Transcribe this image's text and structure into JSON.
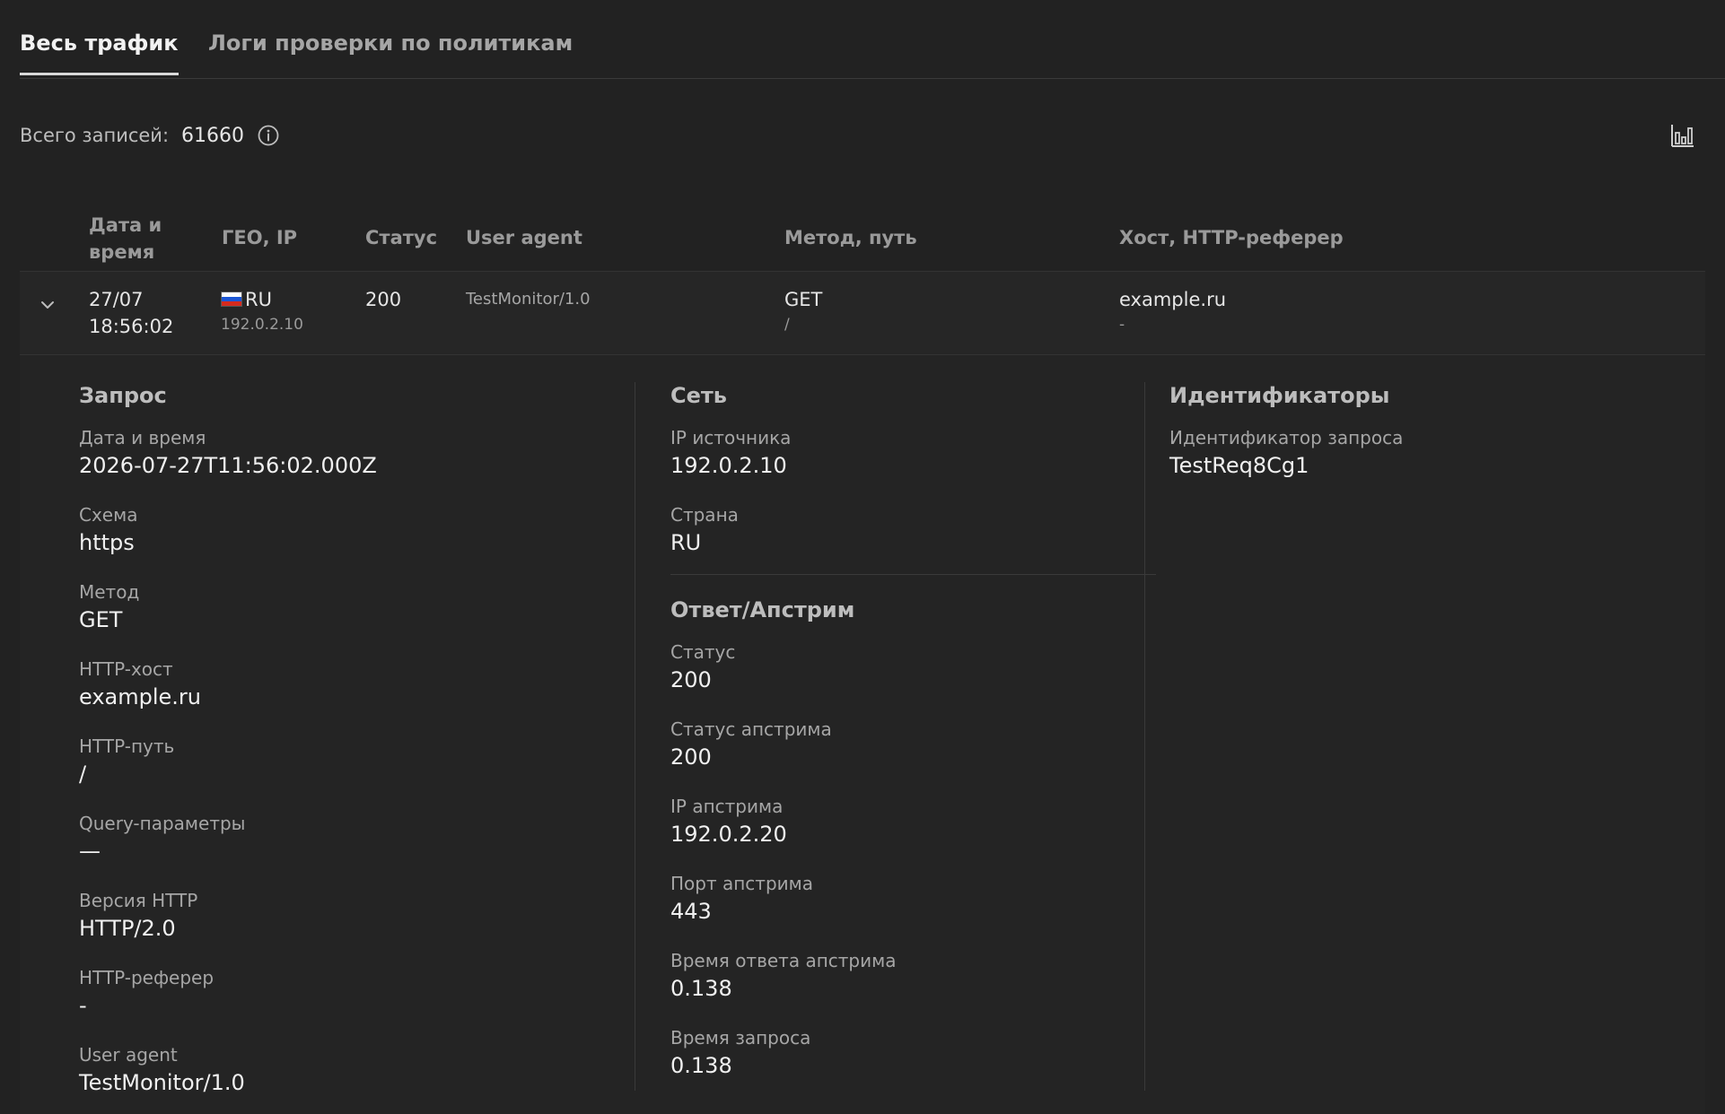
{
  "tabs": [
    {
      "label": "Весь трафик",
      "active": true
    },
    {
      "label": "Логи проверки по политикам",
      "active": false
    }
  ],
  "summary": {
    "label": "Всего записей:",
    "count": "61660"
  },
  "table": {
    "columns": {
      "date": "Дата и время",
      "geo": "ГЕО, IP",
      "status": "Статус",
      "user_agent": "User agent",
      "method": "Метод, путь",
      "host": "Хост, HTTP-реферер"
    },
    "row": {
      "date": "27/07",
      "time": "18:56:02",
      "country": "RU",
      "ip": "192.0.2.10",
      "status": "200",
      "user_agent": "TestMonitor/1.0",
      "method": "GET",
      "path": "/",
      "host": "example.ru",
      "referer": "-"
    }
  },
  "detail": {
    "request": {
      "title": "Запрос",
      "fields": [
        {
          "label": "Дата и время",
          "value": "2026-07-27T11:56:02.000Z"
        },
        {
          "label": "Схема",
          "value": "https"
        },
        {
          "label": "Метод",
          "value": "GET"
        },
        {
          "label": "HTTP-хост",
          "value": "example.ru"
        },
        {
          "label": "HTTP-путь",
          "value": "/"
        },
        {
          "label": "Query-параметры",
          "value": "—"
        },
        {
          "label": "Версия HTTP",
          "value": "HTTP/2.0"
        },
        {
          "label": "HTTP-реферер",
          "value": "-"
        },
        {
          "label": "User agent",
          "value": "TestMonitor/1.0"
        }
      ]
    },
    "network": {
      "title": "Сеть",
      "fields": [
        {
          "label": "IP источника",
          "value": "192.0.2.10"
        },
        {
          "label": "Страна",
          "value": "RU"
        }
      ]
    },
    "response": {
      "title": "Ответ/Апстрим",
      "fields": [
        {
          "label": "Статус",
          "value": "200"
        },
        {
          "label": "Статус апстрима",
          "value": "200"
        },
        {
          "label": "IP апстрима",
          "value": "192.0.2.20"
        },
        {
          "label": "Порт апстрима",
          "value": "443"
        },
        {
          "label": "Время ответа апстрима",
          "value": "0.138"
        },
        {
          "label": "Время запроса",
          "value": "0.138"
        }
      ]
    },
    "identifiers": {
      "title": "Идентификаторы",
      "fields": [
        {
          "label": "Идентификатор запроса",
          "value": "TestReq8Cg1"
        }
      ]
    }
  },
  "icons": {
    "info": "info-icon",
    "chart": "bar-chart-icon",
    "chevron": "chevron-down-icon",
    "flag": "flag-ru-icon"
  }
}
